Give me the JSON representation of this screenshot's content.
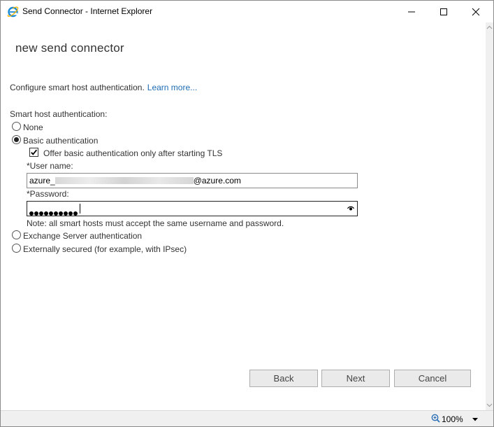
{
  "window": {
    "title": "Send Connector - Internet Explorer",
    "icon": "internet-explorer-icon"
  },
  "page": {
    "title": "new send connector",
    "intro_text": "Configure smart host authentication.",
    "learn_more": "Learn more...",
    "section_label": "Smart host authentication:"
  },
  "auth_options": {
    "none": "None",
    "basic": "Basic authentication",
    "basic_tls": "Offer basic authentication only after starting TLS",
    "exchange": "Exchange Server authentication",
    "external": "Externally secured (for example, with IPsec)",
    "selected": "basic",
    "tls_checked": true
  },
  "fields": {
    "username_label": "*User name:",
    "username_prefix": "azure_",
    "username_suffix": "@azure.com",
    "password_label": "*Password:",
    "password_mask_count": 10,
    "note": "Note: all smart hosts must accept the same username and password."
  },
  "buttons": {
    "back": "Back",
    "next": "Next",
    "cancel": "Cancel"
  },
  "statusbar": {
    "zoom": "100%"
  },
  "colors": {
    "link": "#1e6cb3",
    "ie_blue": "#1a8ad6"
  }
}
